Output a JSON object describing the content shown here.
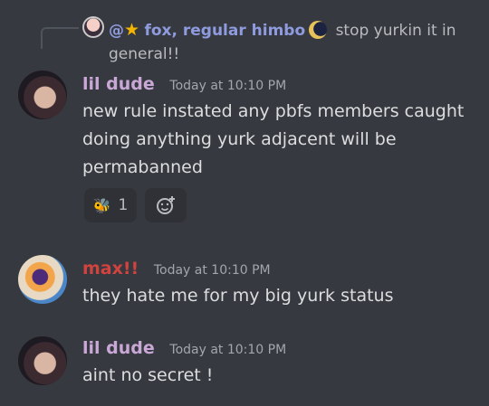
{
  "reply": {
    "mention_prefix": "@",
    "author": "fox, regular himbo",
    "text_line1": "stop yurkin it in",
    "text_line2": "general!!"
  },
  "messages": [
    {
      "author": "lil dude",
      "timestamp": "Today at 10:10 PM",
      "lines": [
        "new rule instated any pbfs members caught",
        "doing anything yurk adjacent will be",
        "permabanned"
      ],
      "reaction": {
        "count": "1"
      }
    },
    {
      "author": "max!!",
      "timestamp": "Today at 10:10 PM",
      "lines": [
        "they hate me for my big yurk status"
      ]
    },
    {
      "author": "lil dude",
      "timestamp": "Today at 10:10 PM",
      "lines": [
        "aint no secret !"
      ]
    }
  ],
  "colors": {
    "background": "#36393f",
    "lil_dude_name": "#c9a7d6",
    "max_name": "#d1433f",
    "reply_author": "#8f9bdf"
  },
  "icons": [
    "reply-avatar",
    "star-icon",
    "moon-icon",
    "reaction-emoji-icon",
    "add-reaction-icon"
  ]
}
